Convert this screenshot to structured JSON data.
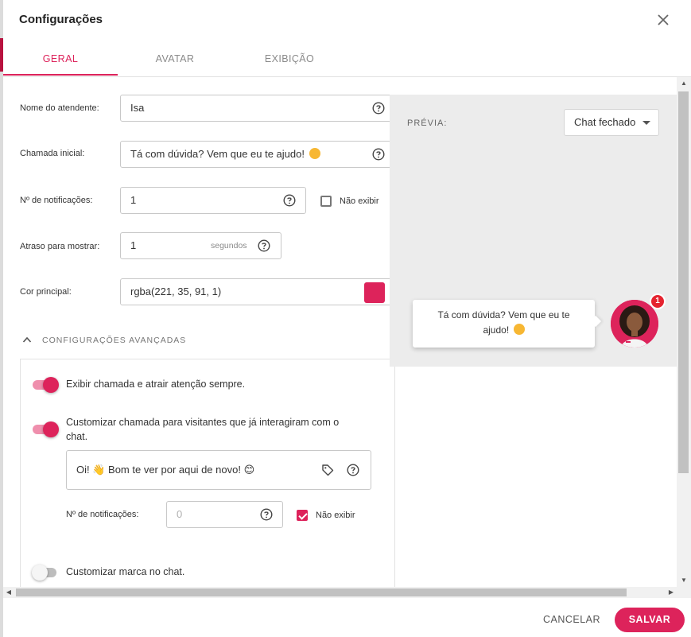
{
  "dialog": {
    "title": "Configurações"
  },
  "tabs": [
    {
      "label": "GERAL",
      "active": true
    },
    {
      "label": "AVATAR",
      "active": false
    },
    {
      "label": "EXIBIÇÃO",
      "active": false
    }
  ],
  "form": {
    "attendant_name": {
      "label": "Nome do atendente:",
      "value": "Isa"
    },
    "initial_call": {
      "label": "Chamada inicial:",
      "value": "Tá com dúvida? Vem que eu te ajudo!"
    },
    "notifications": {
      "label": "Nº de notificações:",
      "value": "1",
      "hide_label": "Não exibir",
      "hide_checked": false
    },
    "delay": {
      "label": "Atraso para mostrar:",
      "value": "1",
      "suffix": "segundos"
    },
    "main_color": {
      "label": "Cor principal:",
      "value": "rgba(221, 35, 91, 1)",
      "swatch": "#dd235b"
    }
  },
  "advanced": {
    "header": "CONFIGURAÇÕES AVANÇADAS",
    "expanded": true,
    "toggle_always_show": {
      "label": "Exibir chamada e atrair atenção sempre.",
      "on": true
    },
    "toggle_returning": {
      "label": "Customizar chamada para visitantes que já interagiram com o chat.",
      "on": true
    },
    "returning_message": {
      "value": "Oi! 👋 Bom te ver por aqui de novo! 😊"
    },
    "returning_notifications": {
      "label": "Nº de notificações:",
      "placeholder": "0",
      "hide_label": "Não exibir",
      "hide_checked": true
    },
    "toggle_brand": {
      "label": "Customizar marca no chat.",
      "on": false
    }
  },
  "preview": {
    "label": "PRÉVIA:",
    "state_select": "Chat fechado",
    "bubble_text": "Tá com dúvida? Vem que eu te ajudo!",
    "badge_count": "1"
  },
  "footer": {
    "cancel": "CANCELAR",
    "save": "SALVAR"
  },
  "colors": {
    "accent": "#dd235b",
    "badge": "#e5232f",
    "preview_bg": "#ececec"
  },
  "icons": [
    "close-icon",
    "help-circle-icon",
    "chevron-up-icon",
    "tag-icon",
    "caret-down-icon",
    "emoji-icon"
  ]
}
